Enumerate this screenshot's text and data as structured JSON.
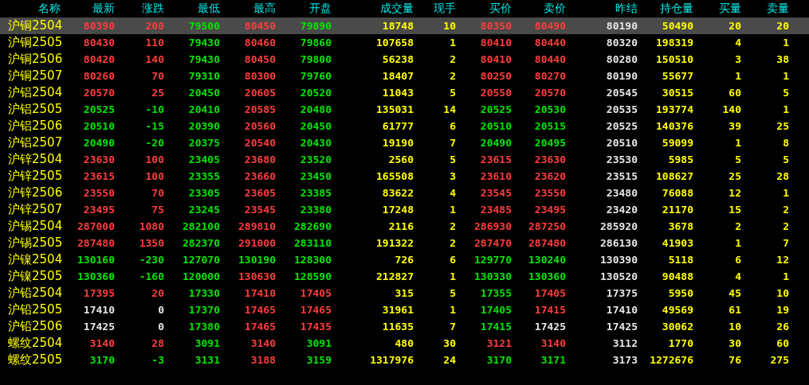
{
  "table": {
    "columns": [
      {
        "label": "名称",
        "kind": "name"
      },
      {
        "label": "最新",
        "kind": "price"
      },
      {
        "label": "涨跌",
        "kind": "change"
      },
      {
        "label": "最低",
        "kind": "price"
      },
      {
        "label": "最高",
        "kind": "price"
      },
      {
        "label": "开盘",
        "kind": "price"
      },
      {
        "label": "成交量",
        "kind": "volume"
      },
      {
        "label": "现手",
        "kind": "volume"
      },
      {
        "label": "买价",
        "kind": "price"
      },
      {
        "label": "卖价",
        "kind": "price"
      },
      {
        "label": "昨结",
        "kind": "prev"
      },
      {
        "label": "持仓量",
        "kind": "volume"
      },
      {
        "label": "买量",
        "kind": "volume"
      },
      {
        "label": "卖量",
        "kind": "volume"
      }
    ],
    "rows": [
      {
        "selected": true,
        "cells": [
          "沪铜2504",
          "80390",
          "200",
          "79500",
          "80450",
          "79890",
          "18748",
          "10",
          "80350",
          "80490",
          "80190",
          "50490",
          "20",
          "20"
        ]
      },
      {
        "selected": false,
        "cells": [
          "沪铜2505",
          "80430",
          "110",
          "79430",
          "80460",
          "79860",
          "107658",
          "1",
          "80410",
          "80440",
          "80320",
          "198319",
          "4",
          "1"
        ]
      },
      {
        "selected": false,
        "cells": [
          "沪铜2506",
          "80420",
          "140",
          "79430",
          "80450",
          "79800",
          "56238",
          "2",
          "80410",
          "80440",
          "80280",
          "150510",
          "3",
          "38"
        ]
      },
      {
        "selected": false,
        "cells": [
          "沪铜2507",
          "80260",
          "70",
          "79310",
          "80300",
          "79760",
          "18407",
          "2",
          "80250",
          "80270",
          "80190",
          "55677",
          "1",
          "1"
        ]
      },
      {
        "selected": false,
        "cells": [
          "沪铝2504",
          "20570",
          "25",
          "20450",
          "20605",
          "20520",
          "11043",
          "5",
          "20550",
          "20570",
          "20545",
          "30515",
          "60",
          "5"
        ]
      },
      {
        "selected": false,
        "cells": [
          "沪铝2505",
          "20525",
          "-10",
          "20410",
          "20585",
          "20480",
          "135031",
          "14",
          "20525",
          "20530",
          "20535",
          "193774",
          "140",
          "1"
        ]
      },
      {
        "selected": false,
        "cells": [
          "沪铝2506",
          "20510",
          "-15",
          "20390",
          "20560",
          "20450",
          "61777",
          "6",
          "20510",
          "20515",
          "20525",
          "140376",
          "39",
          "25"
        ]
      },
      {
        "selected": false,
        "cells": [
          "沪铝2507",
          "20490",
          "-20",
          "20375",
          "20540",
          "20430",
          "19190",
          "7",
          "20490",
          "20495",
          "20510",
          "59099",
          "1",
          "8"
        ]
      },
      {
        "selected": false,
        "cells": [
          "沪锌2504",
          "23630",
          "100",
          "23405",
          "23680",
          "23520",
          "2560",
          "5",
          "23615",
          "23630",
          "23530",
          "5985",
          "5",
          "5"
        ]
      },
      {
        "selected": false,
        "cells": [
          "沪锌2505",
          "23615",
          "100",
          "23355",
          "23660",
          "23450",
          "165508",
          "3",
          "23610",
          "23620",
          "23515",
          "108627",
          "25",
          "28"
        ]
      },
      {
        "selected": false,
        "cells": [
          "沪锌2506",
          "23550",
          "70",
          "23305",
          "23605",
          "23385",
          "83622",
          "4",
          "23545",
          "23550",
          "23480",
          "76088",
          "12",
          "1"
        ]
      },
      {
        "selected": false,
        "cells": [
          "沪锌2507",
          "23495",
          "75",
          "23245",
          "23545",
          "23380",
          "17248",
          "1",
          "23485",
          "23495",
          "23420",
          "21170",
          "15",
          "2"
        ]
      },
      {
        "selected": false,
        "cells": [
          "沪锡2504",
          "287000",
          "1080",
          "282100",
          "289810",
          "282690",
          "2116",
          "2",
          "286930",
          "287250",
          "285920",
          "3678",
          "2",
          "2"
        ]
      },
      {
        "selected": false,
        "cells": [
          "沪锡2505",
          "287480",
          "1350",
          "282370",
          "291000",
          "283110",
          "191322",
          "2",
          "287470",
          "287480",
          "286130",
          "41903",
          "1",
          "7"
        ]
      },
      {
        "selected": false,
        "cells": [
          "沪镍2504",
          "130160",
          "-230",
          "127070",
          "130190",
          "128300",
          "726",
          "6",
          "129770",
          "130240",
          "130390",
          "5118",
          "6",
          "12"
        ]
      },
      {
        "selected": false,
        "cells": [
          "沪镍2505",
          "130360",
          "-160",
          "120000",
          "130630",
          "128590",
          "212827",
          "1",
          "130330",
          "130360",
          "130520",
          "90488",
          "4",
          "1"
        ]
      },
      {
        "selected": false,
        "cells": [
          "沪铅2504",
          "17395",
          "20",
          "17330",
          "17410",
          "17405",
          "315",
          "5",
          "17355",
          "17405",
          "17375",
          "5950",
          "45",
          "10"
        ]
      },
      {
        "selected": false,
        "cells": [
          "沪铅2505",
          "17410",
          "0",
          "17370",
          "17465",
          "17465",
          "31961",
          "1",
          "17405",
          "17415",
          "17410",
          "49569",
          "61",
          "19"
        ]
      },
      {
        "selected": false,
        "cells": [
          "沪铅2506",
          "17425",
          "0",
          "17380",
          "17465",
          "17435",
          "11635",
          "7",
          "17415",
          "17425",
          "17425",
          "30062",
          "10",
          "26"
        ]
      },
      {
        "selected": false,
        "cells": [
          "螺纹2504",
          "3140",
          "28",
          "3091",
          "3140",
          "3091",
          "480",
          "30",
          "3121",
          "3140",
          "3112",
          "1770",
          "30",
          "60"
        ]
      },
      {
        "selected": false,
        "cells": [
          "螺纹2505",
          "3170",
          "-3",
          "3131",
          "3188",
          "3159",
          "1317976",
          "24",
          "3170",
          "3171",
          "3173",
          "1272676",
          "76",
          "275"
        ]
      }
    ]
  }
}
